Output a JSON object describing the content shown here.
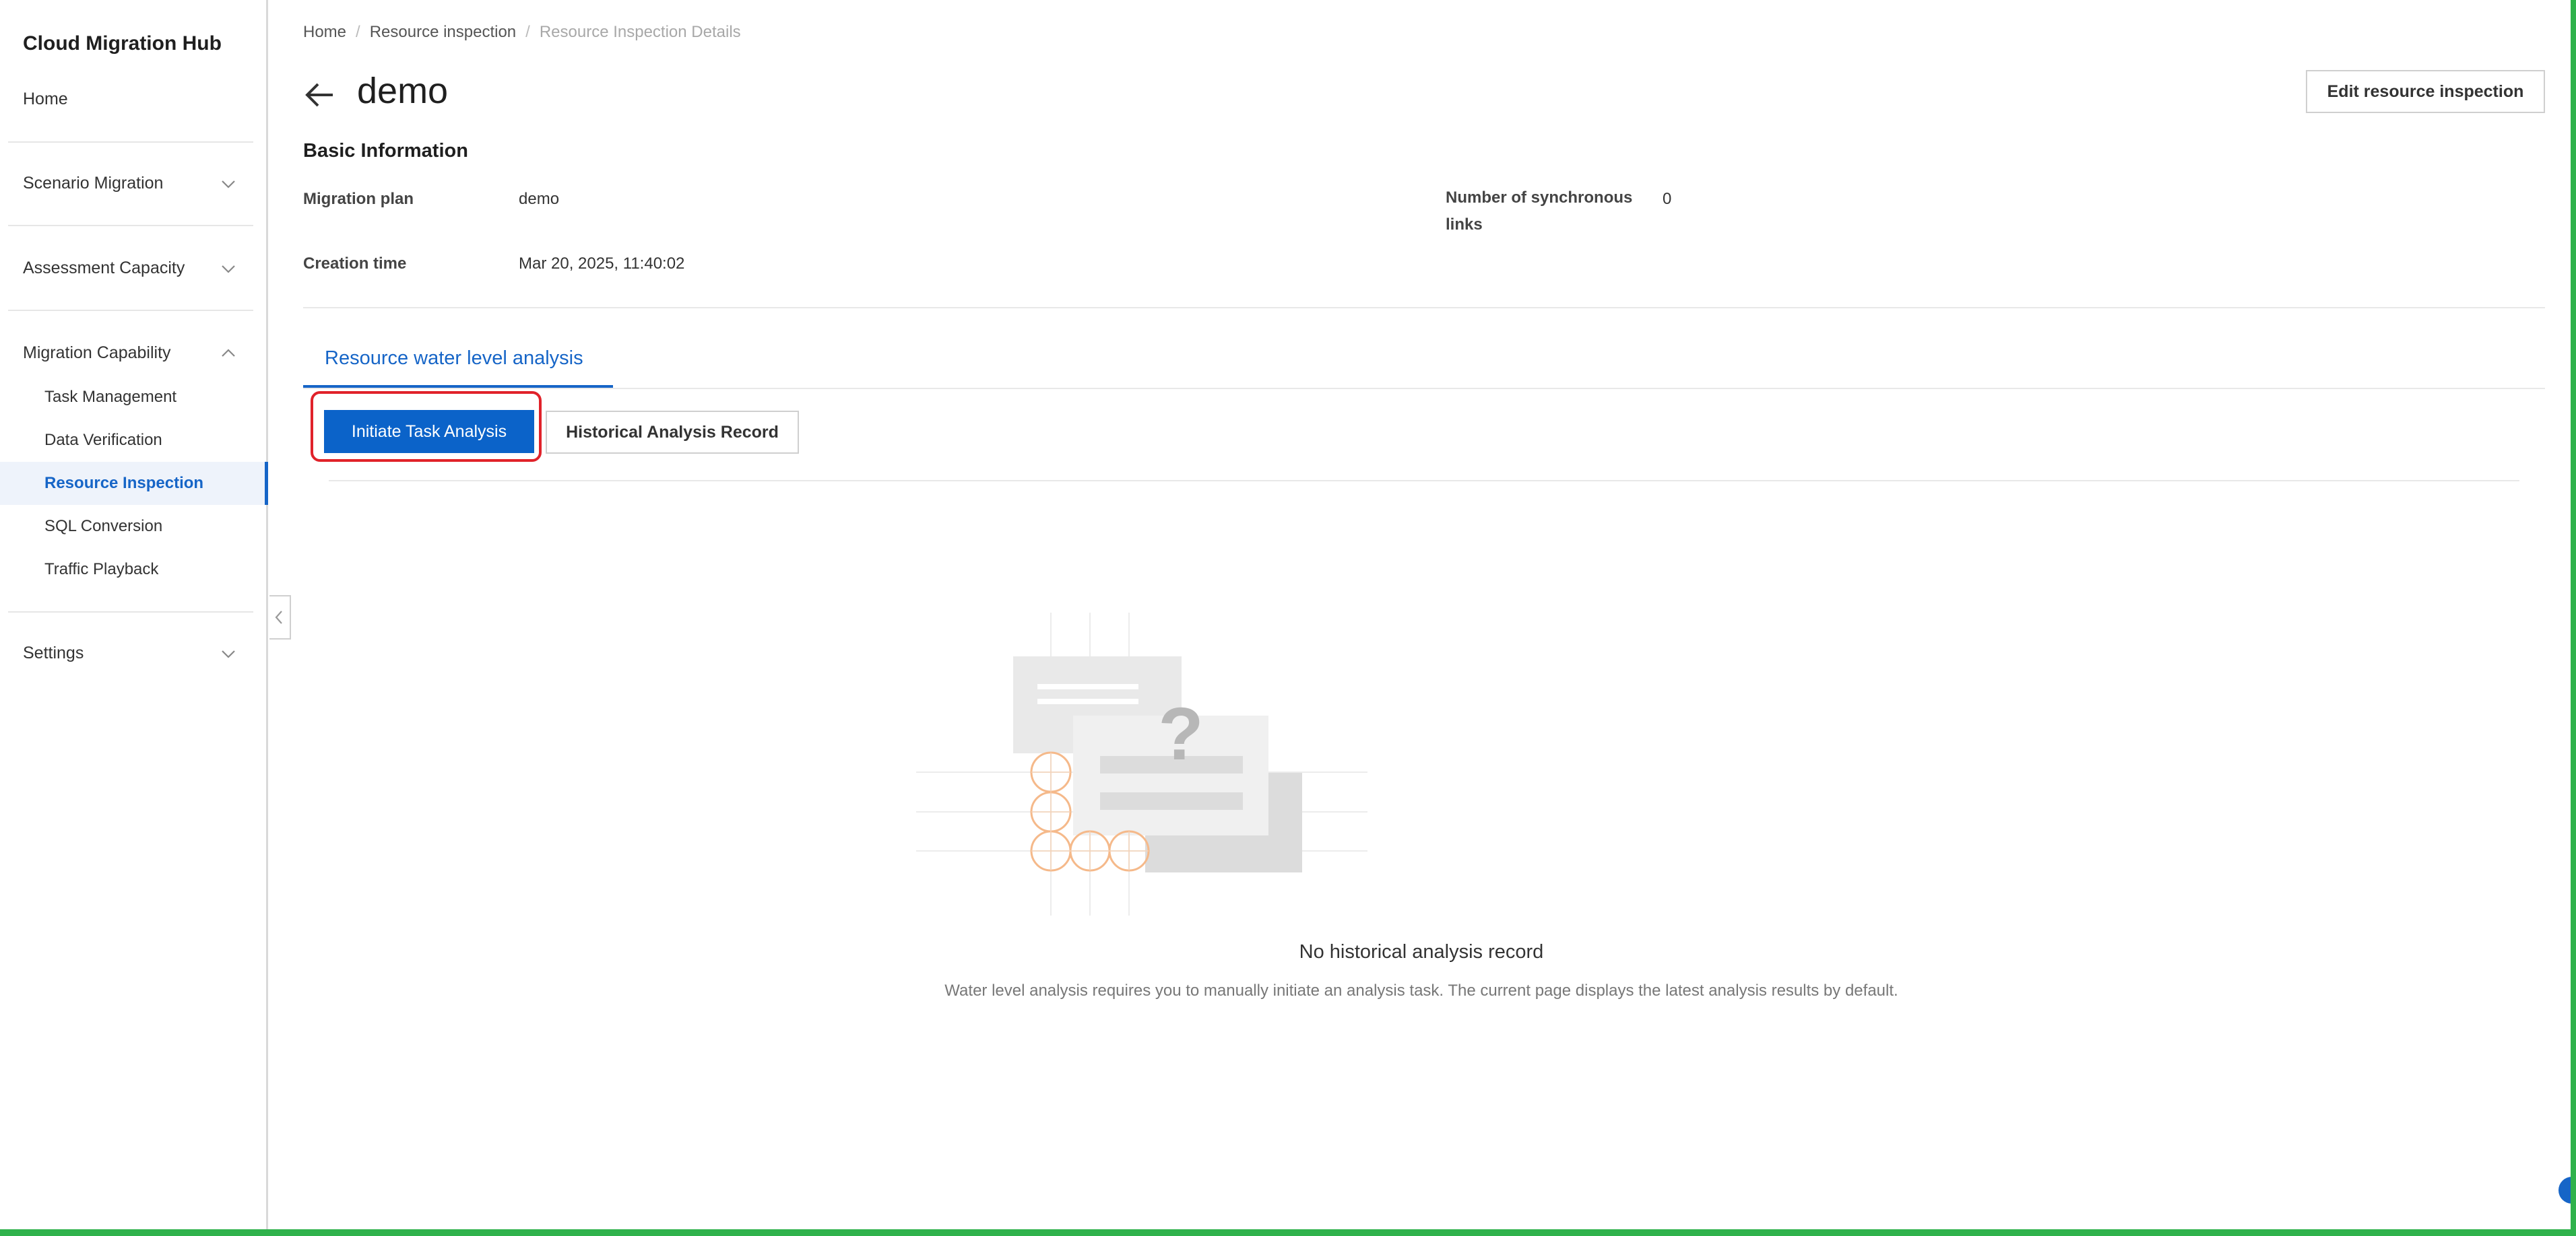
{
  "app": {
    "title": "Cloud Migration Hub"
  },
  "sidebar": {
    "home": "Home",
    "groups": [
      {
        "label": "Scenario Migration",
        "expanded": false
      },
      {
        "label": "Assessment Capacity",
        "expanded": false
      },
      {
        "label": "Migration Capability",
        "expanded": true
      },
      {
        "label": "Settings",
        "expanded": false
      }
    ],
    "items": [
      {
        "label": "Task Management"
      },
      {
        "label": "Data Verification"
      },
      {
        "label": "Resource Inspection",
        "active": true
      },
      {
        "label": "SQL Conversion"
      },
      {
        "label": "Traffic Playback"
      }
    ]
  },
  "breadcrumb": {
    "items": [
      "Home",
      "Resource inspection",
      "Resource Inspection Details"
    ],
    "separator": "/"
  },
  "header": {
    "title": "demo",
    "edit_button": "Edit resource inspection"
  },
  "basic_info": {
    "section_title": "Basic Information",
    "migration_plan_label": "Migration plan",
    "migration_plan_value": "demo",
    "creation_time_label": "Creation time",
    "creation_time_value": "Mar 20, 2025, 11:40:02",
    "sync_links_label_line1": "Number of synchronous",
    "sync_links_label_line2": "links",
    "sync_links_value": "0"
  },
  "tabs": [
    {
      "label": "Resource water level analysis",
      "active": true
    }
  ],
  "actions": {
    "initiate": "Initiate Task Analysis",
    "history": "Historical Analysis Record"
  },
  "empty_state": {
    "title": "No historical analysis record",
    "description": "Water level analysis requires you to manually initiate an analysis task. The current page displays the latest analysis results by default."
  },
  "colors": {
    "accent": "#1665c7",
    "primary_button": "#0b63c9",
    "highlight": "#e0222a",
    "frame": "#2fb24c"
  }
}
